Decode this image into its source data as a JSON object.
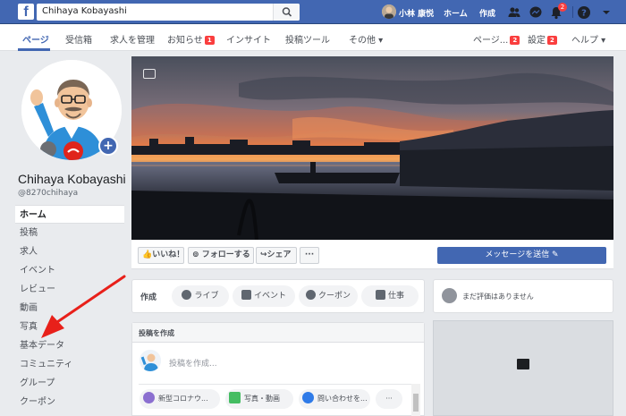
{
  "topbar": {
    "search_value": "Chihaya Kobayashi",
    "user_name": "小林 康悦",
    "home": "ホーム",
    "create": "作成",
    "notification_count": "2"
  },
  "subnav": {
    "page": "ページ",
    "inbox": "受信箱",
    "jobs": "求人を管理",
    "notifications": "お知らせ",
    "notifications_badge": "1",
    "insights": "インサイト",
    "tools": "投稿ツール",
    "more": "その他 ▾",
    "page_right": "ページ...",
    "page_right_badge": "2",
    "settings": "設定",
    "settings_badge": "2",
    "help": "ヘルプ ▾"
  },
  "profile": {
    "name": "Chihaya Kobayashi",
    "handle": "@8270chihaya"
  },
  "leftnav": [
    {
      "label": "ホーム"
    },
    {
      "label": "投稿"
    },
    {
      "label": "求人"
    },
    {
      "label": "イベント"
    },
    {
      "label": "レビュー"
    },
    {
      "label": "動画"
    },
    {
      "label": "写真"
    },
    {
      "label": "基本データ"
    },
    {
      "label": "コミュニティ"
    },
    {
      "label": "グループ"
    },
    {
      "label": "クーポン"
    }
  ],
  "actions": {
    "like": "いいね！",
    "follow": "フォローする",
    "share": "シェア",
    "more": "···",
    "send_message": "メッセージを送信 ✎"
  },
  "create_bar": {
    "label": "作成",
    "live": "ライブ",
    "event": "イベント",
    "coupon": "クーポン",
    "job": "仕事"
  },
  "reviews": {
    "text": "まだ評価はありません"
  },
  "post": {
    "header": "投稿を作成",
    "placeholder": "投稿を作成...",
    "covid": "新型コロナウ...",
    "photo_video": "写真・動画",
    "contact": "問い合わせを...",
    "more": "···"
  },
  "colors": {
    "brand": "#4267b2",
    "badge": "#fa3e3e",
    "arrow": "#e8201a"
  }
}
